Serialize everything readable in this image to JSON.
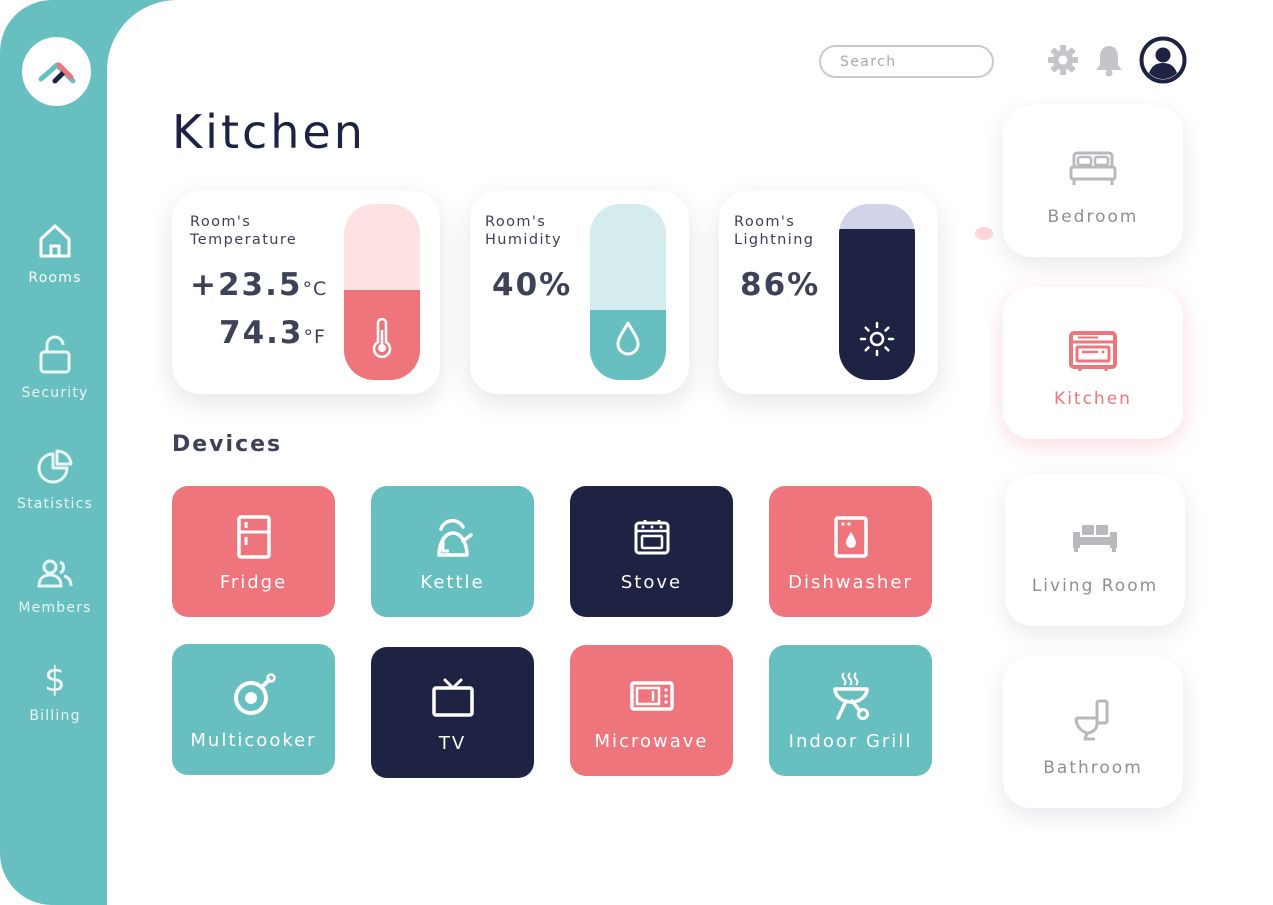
{
  "colors": {
    "teal": "#67bfc0",
    "coral": "#ee757c",
    "navy": "#1e2344",
    "light_pink": "#fde2e4",
    "light_teal": "#d4ecee",
    "lavender": "#d2d3e8",
    "muted_gray": "#8e8e95"
  },
  "sidebar": {
    "logo_icon": "logo-icon",
    "items": [
      {
        "label": "Rooms",
        "icon": "home-icon",
        "active": true
      },
      {
        "label": "Security",
        "icon": "lock-icon",
        "active": false
      },
      {
        "label": "Statistics",
        "icon": "pie-chart-icon",
        "active": false
      },
      {
        "label": "Members",
        "icon": "users-icon",
        "active": false
      },
      {
        "label": "Billing",
        "icon": "dollar-icon",
        "active": false
      }
    ]
  },
  "header": {
    "search_placeholder": "Search",
    "icons": [
      "gear-icon",
      "bell-icon",
      "user-avatar-icon"
    ]
  },
  "page": {
    "title": "Kitchen"
  },
  "metrics": {
    "temperature": {
      "label": "Room's\nTemperature",
      "celsius_value": "+23.5",
      "celsius_unit": "°C",
      "fahrenheit_value": "74.3",
      "fahrenheit_unit": "°F",
      "level": 0.51,
      "icon": "thermometer-icon"
    },
    "humidity": {
      "label": "Room's\nHumidity",
      "value": "40%",
      "level": 0.4,
      "icon": "droplet-icon"
    },
    "lighting": {
      "label": "Room's\nLightning",
      "value": "86%",
      "level": 0.86,
      "icon": "sun-icon"
    }
  },
  "devices": {
    "title": "Devices",
    "items": [
      {
        "label": "Fridge",
        "icon": "fridge-icon",
        "color": "#ee757c"
      },
      {
        "label": "Kettle",
        "icon": "kettle-icon",
        "color": "#67bfc0"
      },
      {
        "label": "Stove",
        "icon": "stove-icon",
        "color": "#1e2344"
      },
      {
        "label": "Dishwasher",
        "icon": "dishwasher-icon",
        "color": "#ee757c"
      },
      {
        "label": "Multicooker",
        "icon": "multicooker-icon",
        "color": "#67bfc0"
      },
      {
        "label": "TV",
        "icon": "tv-icon",
        "color": "#1e2344"
      },
      {
        "label": "Microwave",
        "icon": "microwave-icon",
        "color": "#ee757c"
      },
      {
        "label": "Indoor Grill",
        "icon": "grill-icon",
        "color": "#67bfc0"
      }
    ]
  },
  "rooms": [
    {
      "label": "Bedroom",
      "icon": "bed-icon",
      "active": false
    },
    {
      "label": "Kitchen",
      "icon": "oven-icon",
      "active": true
    },
    {
      "label": "Living Room",
      "icon": "sofa-icon",
      "active": false
    },
    {
      "label": "Bathroom",
      "icon": "toilet-icon",
      "active": false
    }
  ]
}
